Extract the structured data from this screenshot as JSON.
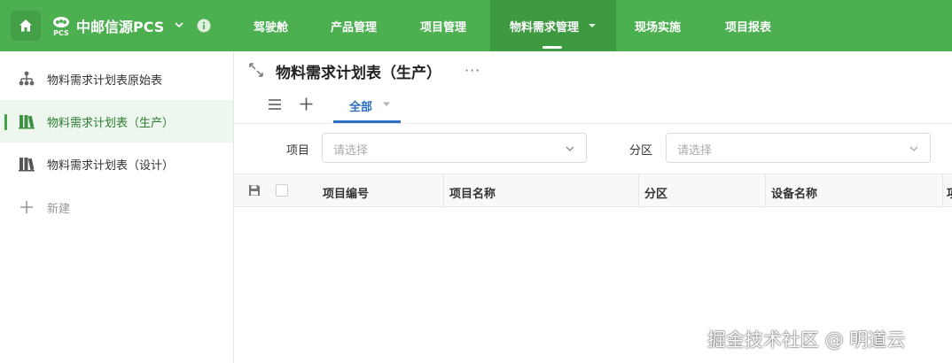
{
  "app": {
    "name": "中邮信源PCS",
    "logo_text": "PCS"
  },
  "nav": {
    "items": [
      {
        "label": "驾驶舱"
      },
      {
        "label": "产品管理"
      },
      {
        "label": "项目管理"
      },
      {
        "label": "物料需求管理"
      },
      {
        "label": "现场实施"
      },
      {
        "label": "项目报表"
      }
    ],
    "active_index": 3
  },
  "sidebar": {
    "items": [
      {
        "label": "物料需求计划表原始表",
        "icon": "org-tree-icon"
      },
      {
        "label": "物料需求计划表（生产）",
        "icon": "books-icon",
        "active": true
      },
      {
        "label": "物料需求计划表（设计）",
        "icon": "books-icon"
      }
    ],
    "new_label": "新建"
  },
  "page": {
    "title": "物料需求计划表（生产）",
    "more": "···",
    "tab_all": "全部"
  },
  "filters": {
    "project": {
      "label": "项目",
      "placeholder": "请选择"
    },
    "zone": {
      "label": "分区",
      "placeholder": "请选择"
    }
  },
  "table": {
    "columns": [
      "项目编号",
      "项目名称",
      "分区",
      "设备名称",
      "项"
    ]
  },
  "watermark": "掘金技术社区 @ 明道云",
  "colors": {
    "brand_green": "#4caf50",
    "active_nav": "#3d9a41",
    "tab_blue": "#2c6dbf"
  }
}
